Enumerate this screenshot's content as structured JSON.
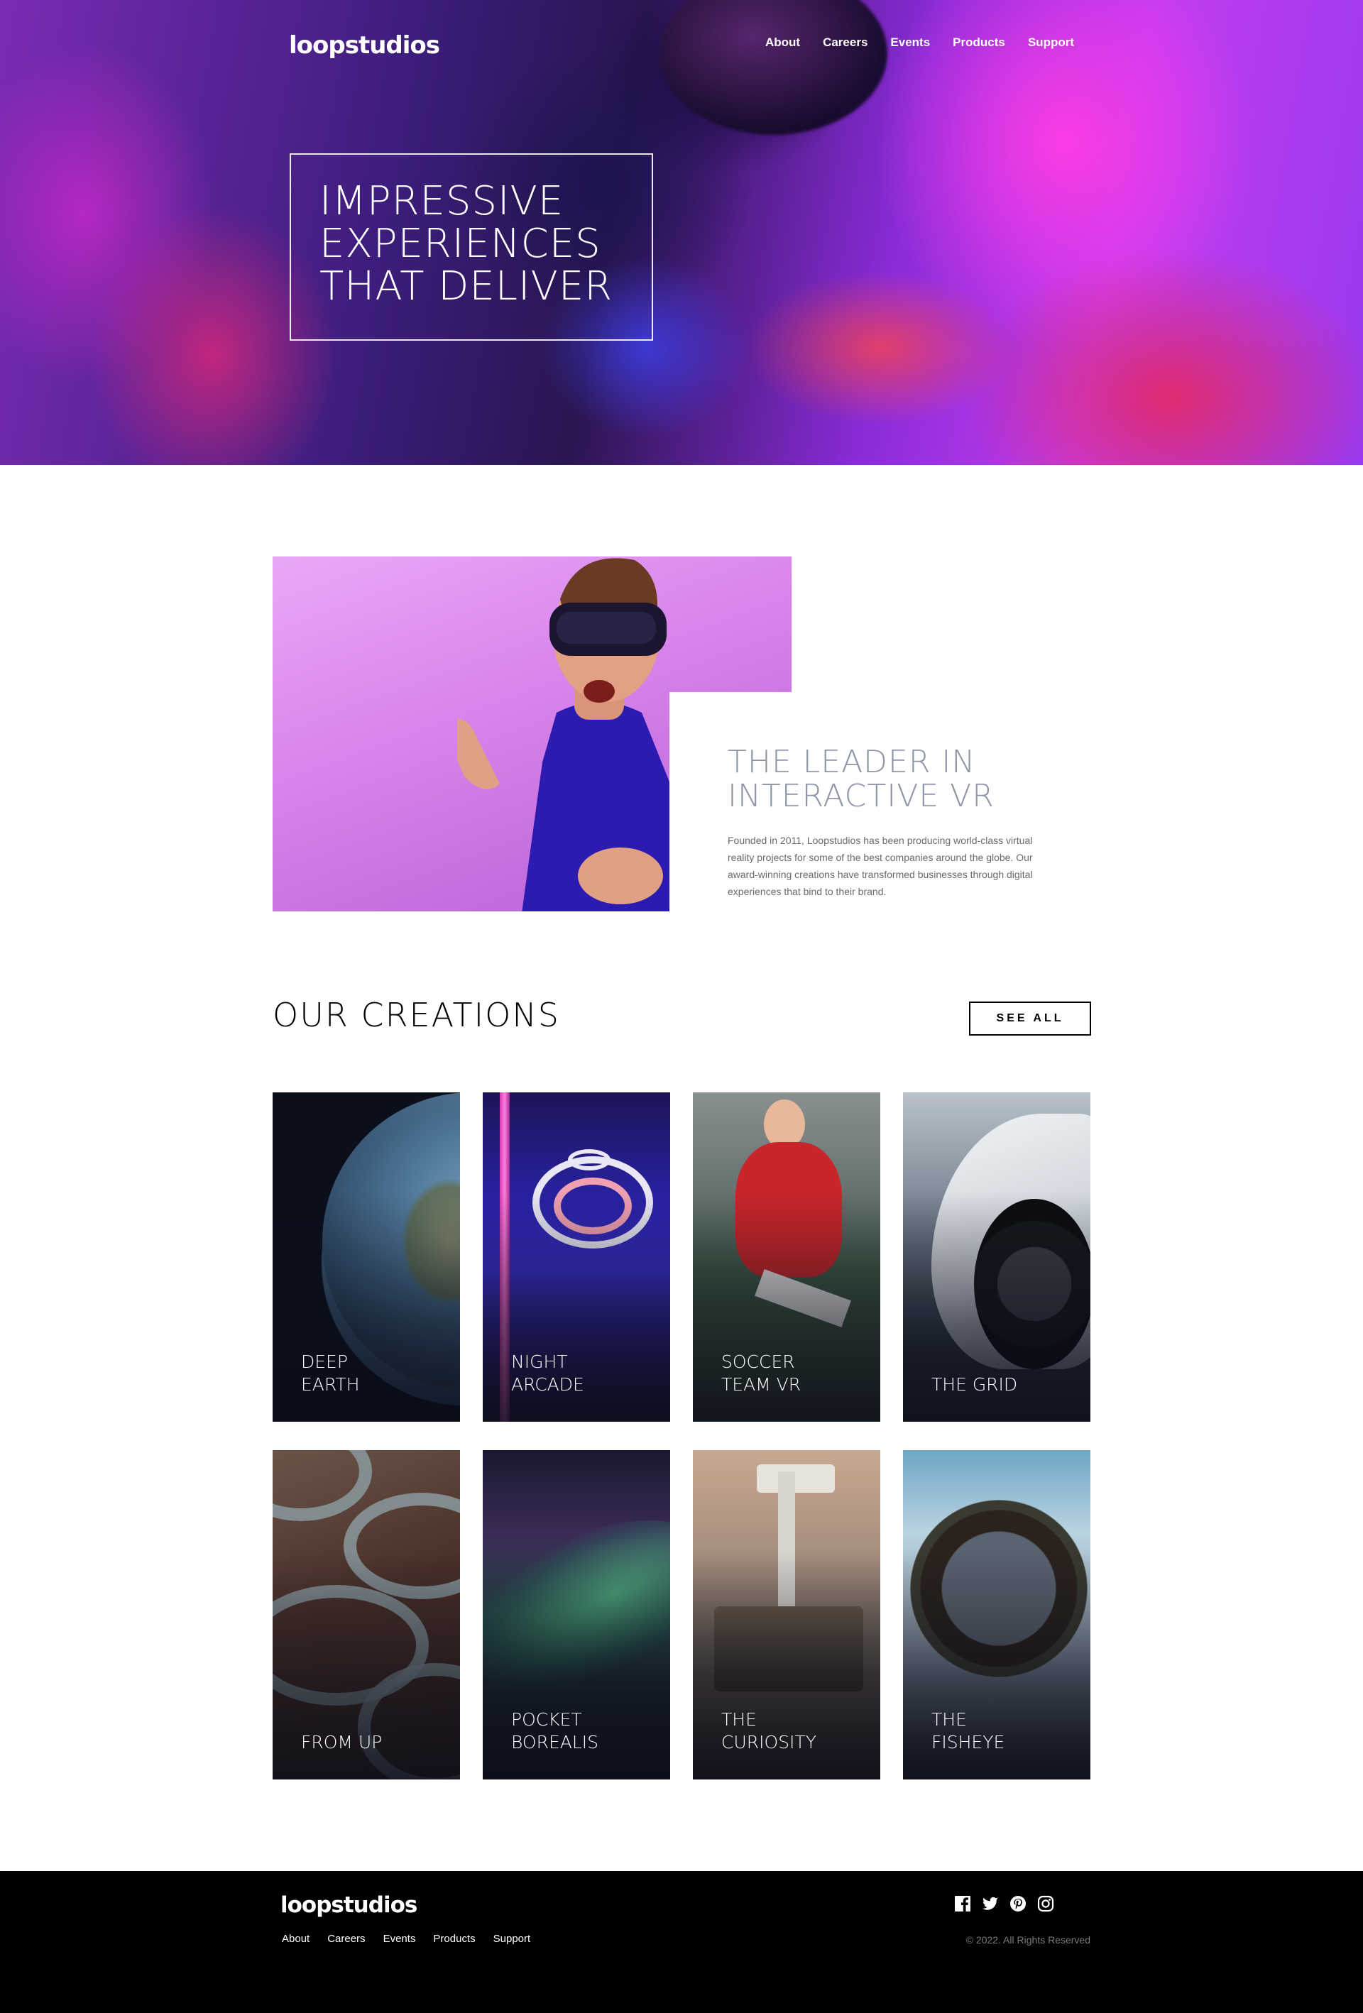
{
  "brand": {
    "logo_text": "loopstudios"
  },
  "header": {
    "nav": [
      "About",
      "Careers",
      "Events",
      "Products",
      "Support"
    ]
  },
  "hero": {
    "headline_lines": [
      "IMPRESSIVE",
      "EXPERIENCES",
      "THAT DELIVER"
    ]
  },
  "intro": {
    "heading_lines": [
      "THE LEADER IN",
      "INTERACTIVE VR"
    ],
    "body": "Founded in 2011, Loopstudios has been producing world-class virtual reality projects for some of the best companies around the globe. Our award-winning creations have transformed businesses through digital experiences that bind to their brand."
  },
  "creations": {
    "title": "OUR CREATIONS",
    "see_all_label": "SEE ALL",
    "items": [
      {
        "label": "DEEP\nEARTH"
      },
      {
        "label": "NIGHT\nARCADE"
      },
      {
        "label": "SOCCER\nTEAM VR"
      },
      {
        "label": "THE GRID"
      },
      {
        "label": "FROM UP"
      },
      {
        "label": "POCKET\nBOREALIS"
      },
      {
        "label": "THE\nCURIOSITY"
      },
      {
        "label": "THE\nFISHEYE"
      }
    ]
  },
  "footer": {
    "logo_text": "loopstudios",
    "nav": [
      "About",
      "Careers",
      "Events",
      "Products",
      "Support"
    ],
    "social_icons": [
      "facebook-icon",
      "twitter-icon",
      "pinterest-icon",
      "instagram-icon"
    ],
    "copyright": "© 2022. All Rights Reserved"
  },
  "colors": {
    "heading_gray": "#8f95a6",
    "body_gray": "#6a6a6a",
    "footer_bg": "#000000",
    "copyright_gray": "#797979"
  }
}
